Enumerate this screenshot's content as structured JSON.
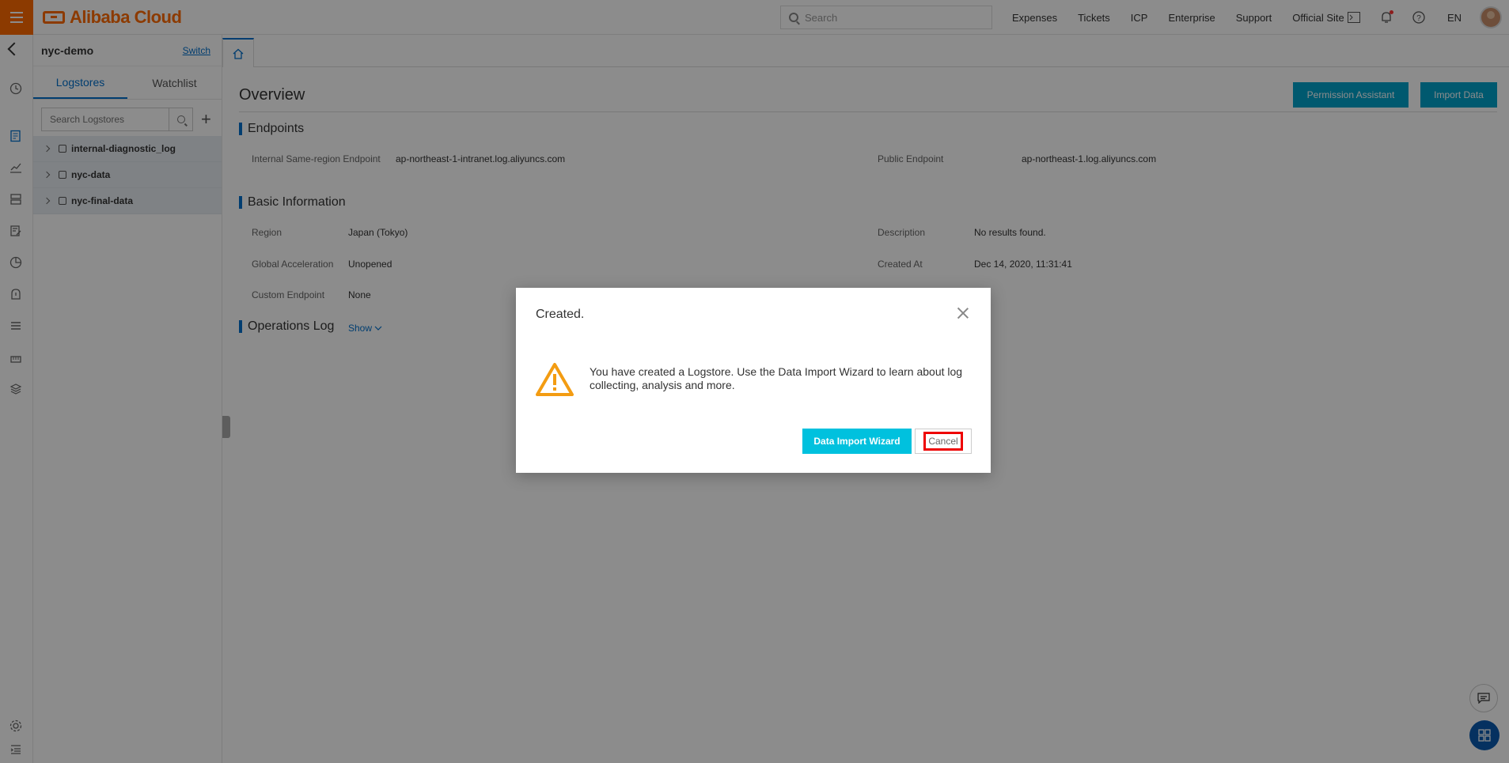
{
  "topbar": {
    "brand": "Alibaba Cloud",
    "search_placeholder": "Search",
    "links": [
      "Expenses",
      "Tickets",
      "ICP",
      "Enterprise",
      "Support",
      "Official Site"
    ],
    "lang": "EN"
  },
  "sidebar": {
    "project": "nyc-demo",
    "switch_label": "Switch",
    "tabs": [
      "Logstores",
      "Watchlist"
    ],
    "search_placeholder": "Search Logstores",
    "logstores": [
      "internal-diagnostic_log",
      "nyc-data",
      "nyc-final-data"
    ]
  },
  "main": {
    "title": "Overview",
    "buttons": {
      "permission": "Permission Assistant",
      "import": "Import Data"
    },
    "endpoints": {
      "title": "Endpoints",
      "internal_label": "Internal Same-region Endpoint",
      "internal_value": "ap-northeast-1-intranet.log.aliyuncs.com",
      "public_label": "Public Endpoint",
      "public_value": "ap-northeast-1.log.aliyuncs.com"
    },
    "basic": {
      "title": "Basic Information",
      "region_label": "Region",
      "region_value": "Japan (Tokyo)",
      "accel_label": "Global Acceleration",
      "accel_value": "Unopened",
      "custom_label": "Custom Endpoint",
      "custom_value": "None",
      "desc_label": "Description",
      "desc_value": "No results found.",
      "created_label": "Created At",
      "created_value": "Dec 14, 2020, 11:31:41"
    },
    "ops": {
      "title": "Operations Log",
      "show_label": "Show"
    }
  },
  "modal": {
    "title": "Created.",
    "message": "You have created a Logstore. Use the Data Import Wizard to learn about log collecting, analysis and more.",
    "wizard_label": "Data Import Wizard",
    "cancel_label": "Cancel"
  },
  "colors": {
    "brand": "#ff6a00",
    "accent": "#00a2ca",
    "link": "#0070cc",
    "highlight": "#e00000"
  }
}
